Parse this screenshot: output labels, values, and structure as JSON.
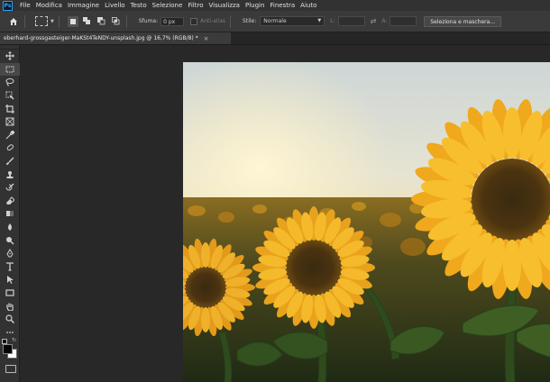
{
  "app": {
    "logo_text": "Ps"
  },
  "menu": {
    "items": [
      "File",
      "Modifica",
      "Immagine",
      "Livello",
      "Testo",
      "Selezione",
      "Filtro",
      "Visualizza",
      "Plugin",
      "Finestra",
      "Aiuto"
    ]
  },
  "options": {
    "sfuma_label": "Sfuma:",
    "sfuma_value": "0 px",
    "antialias_label": "Anti-alias",
    "stile_label": "Stile:",
    "stile_value": "Normale",
    "l_label": "L:",
    "a_label": "A:",
    "select_mask_label": "Seleziona e maschera..."
  },
  "document": {
    "tab_title": "eberhard-grossgasteiger-MaKSt4TeNDY-unsplash.jpg @ 16,7% (RGB/8) *",
    "close_glyph": "×"
  },
  "tools": [
    {
      "name": "move-tool-icon"
    },
    {
      "name": "rectangular-marquee-tool-icon",
      "active": true
    },
    {
      "name": "lasso-tool-icon"
    },
    {
      "name": "object-selection-tool-icon"
    },
    {
      "name": "crop-tool-icon"
    },
    {
      "name": "frame-tool-icon"
    },
    {
      "name": "eyedropper-tool-icon"
    },
    {
      "name": "spot-healing-brush-icon"
    },
    {
      "name": "brush-tool-icon"
    },
    {
      "name": "clone-stamp-tool-icon"
    },
    {
      "name": "history-brush-icon"
    },
    {
      "name": "eraser-tool-icon"
    },
    {
      "name": "gradient-tool-icon"
    },
    {
      "name": "blur-tool-icon"
    },
    {
      "name": "dodge-tool-icon"
    },
    {
      "name": "pen-tool-icon"
    },
    {
      "name": "type-tool-icon"
    },
    {
      "name": "path-selection-tool-icon"
    },
    {
      "name": "rectangle-tool-icon"
    },
    {
      "name": "hand-tool-icon"
    },
    {
      "name": "zoom-tool-icon"
    },
    {
      "name": "more-tools-icon"
    }
  ],
  "colors": {
    "foreground": "#050505",
    "background": "#ffffff",
    "accent": "#31a8ff"
  }
}
